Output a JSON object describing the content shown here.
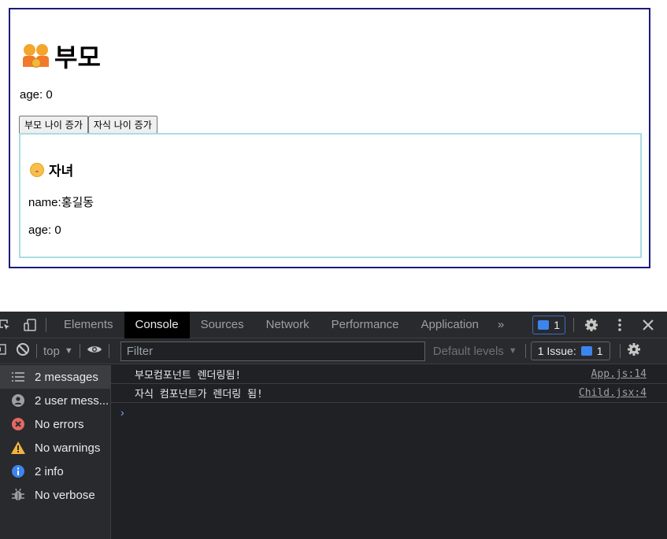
{
  "parent": {
    "icon": "family-emoji-icon",
    "title": "부모",
    "age_text": "age: 0",
    "buttons": [
      "부모 나이 증가",
      "자식 나이 증가"
    ]
  },
  "child": {
    "icon": "baby-emoji-icon",
    "title": "자녀",
    "name_text": "name:홍길동",
    "age_text": "age: 0"
  },
  "devtools": {
    "tabs": [
      "Elements",
      "Console",
      "Sources",
      "Network",
      "Performance",
      "Application"
    ],
    "active_tab": "Console",
    "more_tabs_glyph": "»",
    "message_badge_count": "1",
    "toolbar": {
      "context": "top",
      "filter_placeholder": "Filter",
      "levels": "Default levels",
      "issues_label": "1 Issue:",
      "issues_count": "1"
    },
    "sidebar": [
      {
        "label": "2 messages",
        "icon": "list-icon"
      },
      {
        "label": "2 user mess...",
        "icon": "user-icon"
      },
      {
        "label": "No errors",
        "icon": "error-icon"
      },
      {
        "label": "No warnings",
        "icon": "warning-icon"
      },
      {
        "label": "2 info",
        "icon": "info-icon"
      },
      {
        "label": "No verbose",
        "icon": "bug-icon"
      }
    ],
    "logs": [
      {
        "text": "부모컴포넌트 렌더링됨!",
        "source": "App.js:14"
      },
      {
        "text": "자식 컴포넌트가 렌더링 됨!",
        "source": "Child.jsx:4"
      }
    ],
    "prompt_glyph": "›"
  },
  "colors": {
    "parent_border": "#1b1b7a",
    "child_border": "#a9dde2",
    "devtools_bg": "#202124",
    "error": "#e46962",
    "warning": "#f2b43d",
    "info": "#3d84ef"
  }
}
